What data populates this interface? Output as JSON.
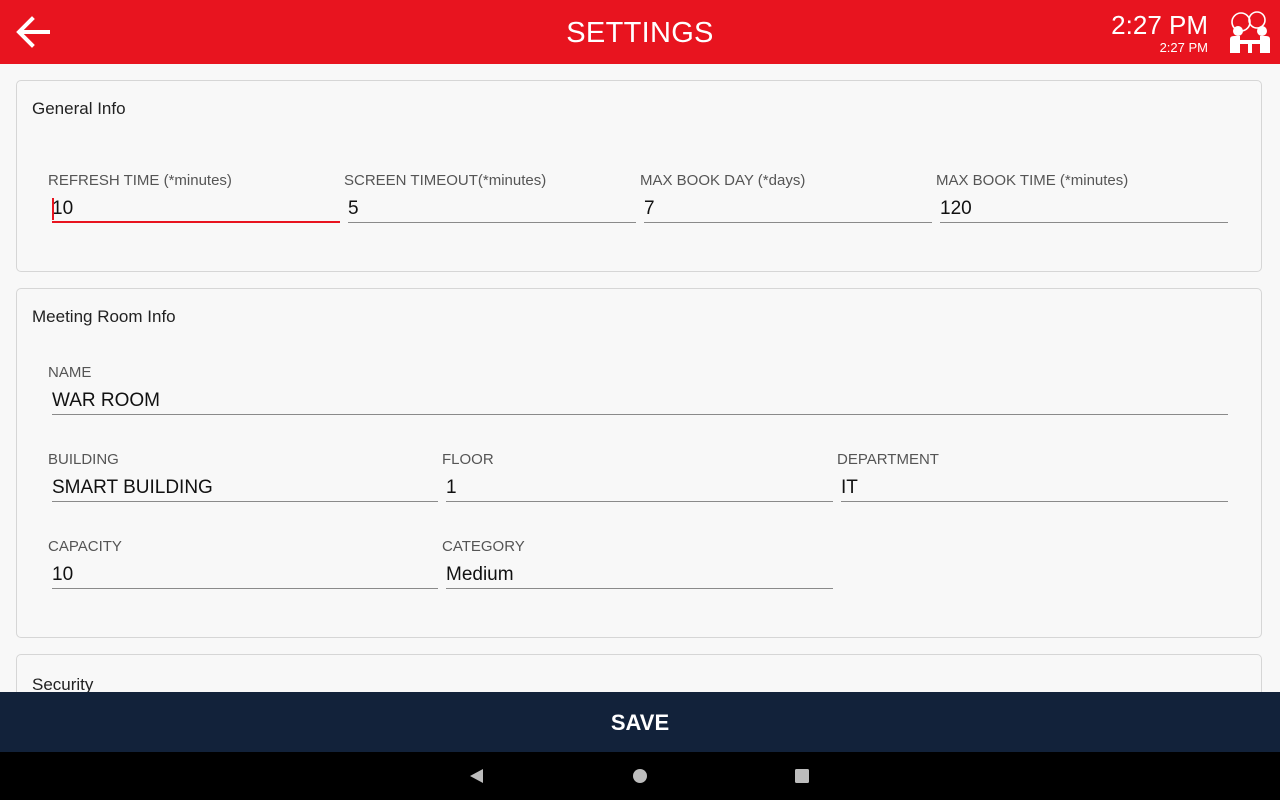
{
  "header": {
    "title": "SETTINGS",
    "time": "2:27 PM",
    "time_small": "2:27 PM",
    "accent_color": "#e8141f"
  },
  "general_info": {
    "title": "General Info",
    "refresh_time": {
      "label": "REFRESH TIME (*minutes)",
      "value": "10"
    },
    "screen_timeout": {
      "label": "SCREEN TIMEOUT(*minutes)",
      "value": "5"
    },
    "max_book_day": {
      "label": "MAX BOOK DAY (*days)",
      "value": "7"
    },
    "max_book_time": {
      "label": "MAX BOOK TIME (*minutes)",
      "value": "120"
    }
  },
  "meeting_room_info": {
    "title": "Meeting Room Info",
    "name": {
      "label": "NAME",
      "value": "WAR ROOM"
    },
    "building": {
      "label": "BUILDING",
      "value": "SMART BUILDING"
    },
    "floor": {
      "label": "FLOOR",
      "value": "1"
    },
    "department": {
      "label": "DEPARTMENT",
      "value": "IT"
    },
    "capacity": {
      "label": "CAPACITY",
      "value": "10"
    },
    "category": {
      "label": "CATEGORY",
      "value": "Medium"
    }
  },
  "security": {
    "title": "Security"
  },
  "footer": {
    "save_label": "SAVE",
    "save_bg_color": "#12223a"
  },
  "icons": {
    "back": "arrow-left-icon",
    "logo": "meeting-room-logo-icon",
    "nav_back": "triangle-back-icon",
    "nav_home": "circle-home-icon",
    "nav_recents": "square-recents-icon"
  }
}
